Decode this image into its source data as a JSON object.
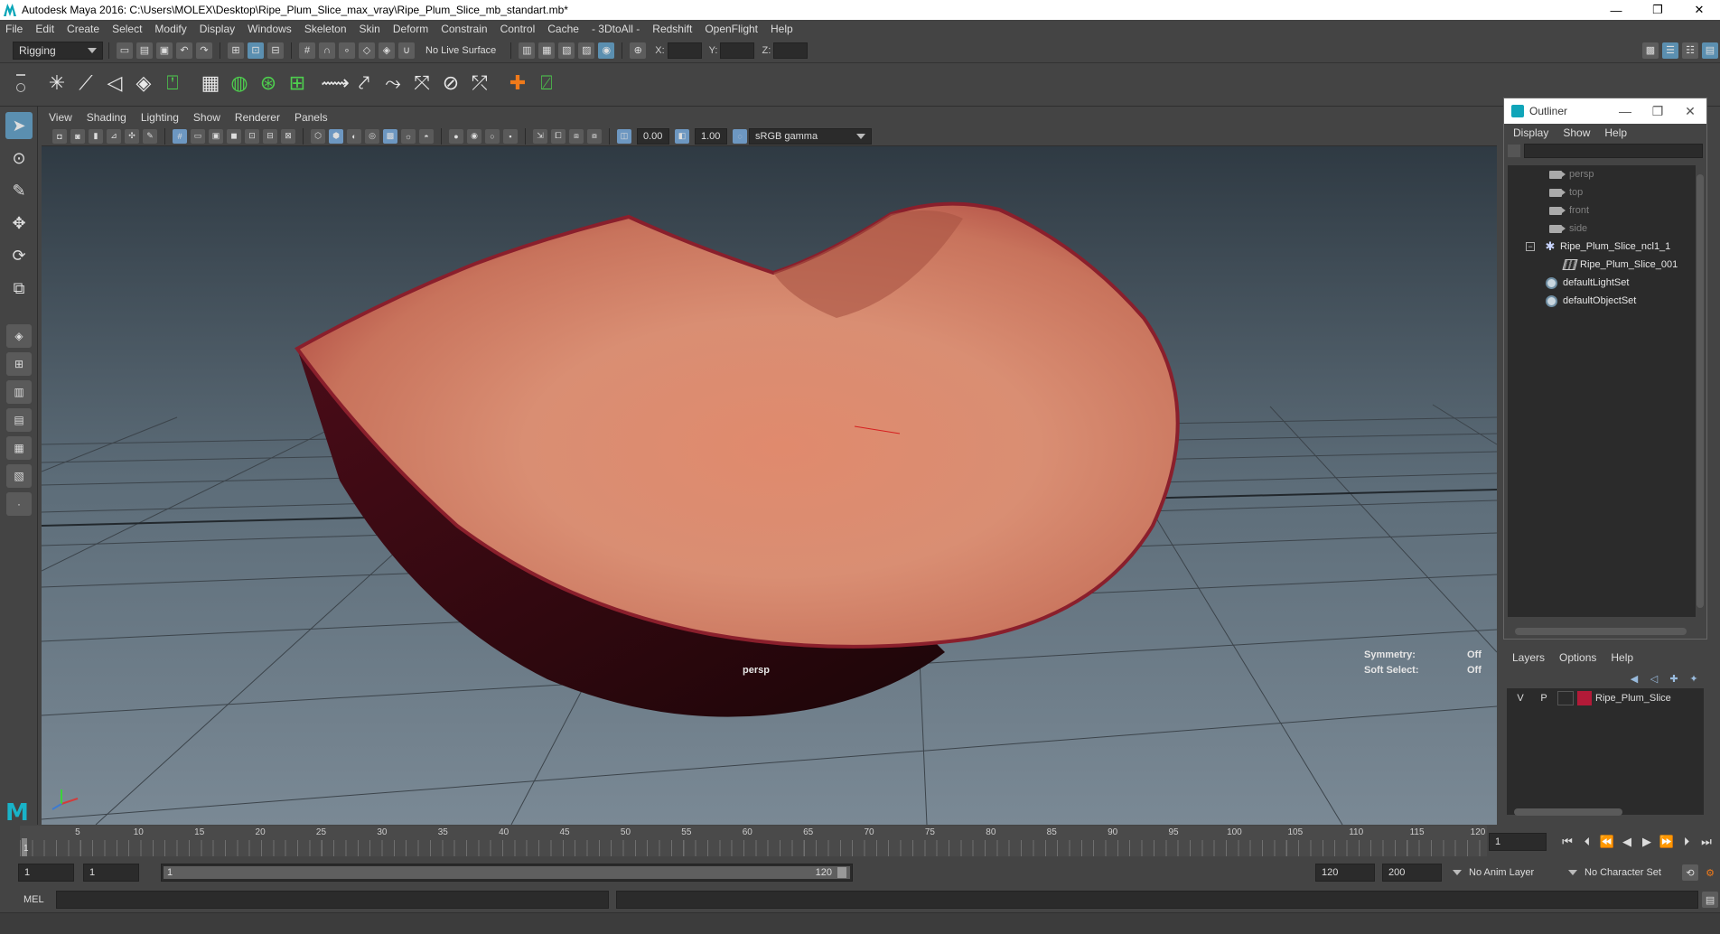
{
  "window": {
    "title": "Autodesk Maya 2016: C:\\Users\\MOLEX\\Desktop\\Ripe_Plum_Slice_max_vray\\Ripe_Plum_Slice_mb_standart.mb*",
    "minimize": "—",
    "restore": "❐",
    "close": "✕"
  },
  "menubar": [
    "File",
    "Edit",
    "Create",
    "Select",
    "Modify",
    "Display",
    "Windows",
    "Skeleton",
    "Skin",
    "Deform",
    "Constrain",
    "Control",
    "Cache",
    "- 3DtoAll -",
    "Redshift",
    "OpenFlight",
    "Help"
  ],
  "status": {
    "menu_set": "Rigging",
    "live_surface": "No Live Surface",
    "x_label": "X:",
    "y_label": "Y:",
    "z_label": "Z:"
  },
  "viewport": {
    "menu": [
      "View",
      "Shading",
      "Lighting",
      "Show",
      "Renderer",
      "Panels"
    ],
    "near_value": "0.00",
    "far_value": "1.00",
    "color_space": "sRGB gamma",
    "camera_label": "persp",
    "symmetry_label": "Symmetry:",
    "symmetry_value": "Off",
    "soft_select_label": "Soft Select:",
    "soft_select_value": "Off"
  },
  "outliner": {
    "title": "Outliner",
    "menu": [
      "Display",
      "Show",
      "Help"
    ],
    "items": [
      {
        "label": "persp",
        "type": "camera"
      },
      {
        "label": "top",
        "type": "camera"
      },
      {
        "label": "front",
        "type": "camera"
      },
      {
        "label": "side",
        "type": "camera"
      },
      {
        "label": "Ripe_Plum_Slice_ncl1_1",
        "type": "group"
      },
      {
        "label": "Ripe_Plum_Slice_001",
        "type": "mesh"
      },
      {
        "label": "defaultLightSet",
        "type": "set"
      },
      {
        "label": "defaultObjectSet",
        "type": "set"
      }
    ],
    "expander": "−"
  },
  "layers": {
    "menu": [
      "Layers",
      "Options",
      "Help"
    ],
    "layer": {
      "v": "V",
      "p": "P",
      "name": "Ripe_Plum_Slice",
      "color": "#b31a38"
    }
  },
  "timeline": {
    "ticks": [
      "5",
      "10",
      "15",
      "20",
      "25",
      "30",
      "35",
      "40",
      "45",
      "50",
      "55",
      "60",
      "65",
      "70",
      "75",
      "80",
      "85",
      "90",
      "95",
      "100",
      "105",
      "110",
      "115",
      "120"
    ],
    "current_frame": "1",
    "current_frame_field": "1"
  },
  "range": {
    "start": "1",
    "playback_start": "1",
    "slider_start": "1",
    "slider_end": "120",
    "playback_end": "120",
    "end": "200",
    "anim_layer": "No Anim Layer",
    "character_set": "No Character Set"
  },
  "command_line": {
    "label": "MEL"
  }
}
